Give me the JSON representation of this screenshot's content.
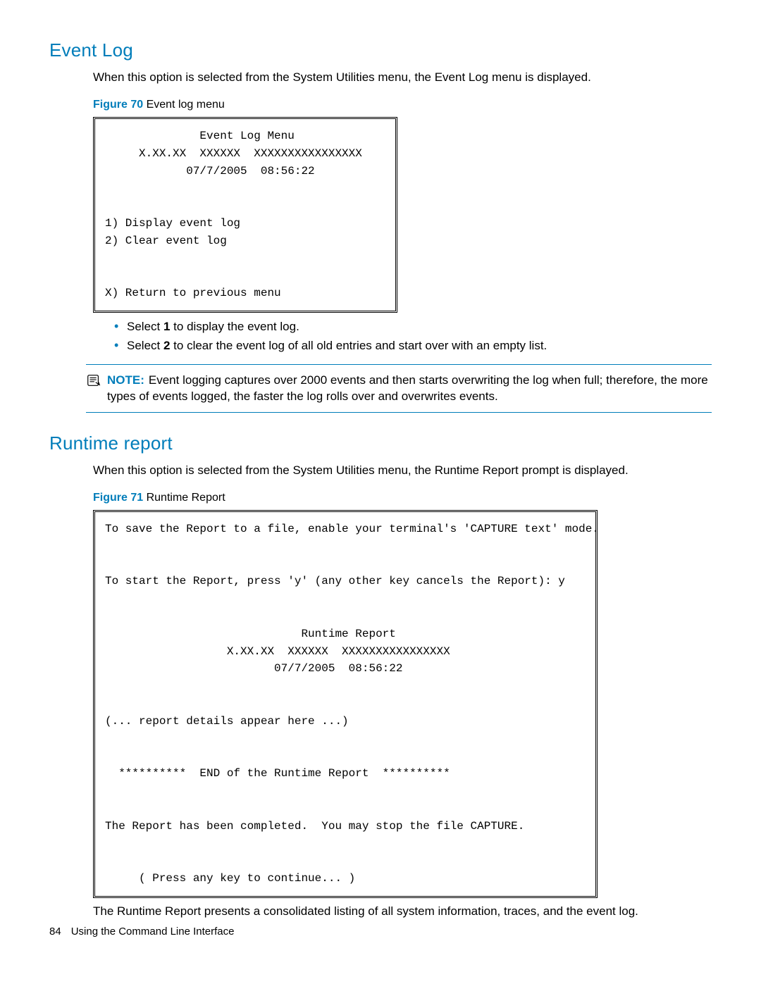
{
  "sections": {
    "eventLog": {
      "title": "Event Log",
      "intro": "When this option is selected from the System Utilities menu, the Event Log menu is displayed.",
      "figure": {
        "label_prefix": "Figure 70",
        "label_rest": " Event log menu",
        "screen": "              Event Log Menu\n     X.XX.XX  XXXXXX  XXXXXXXXXXXXXXXX\n            07/7/2005  08:56:22\n\n\n1) Display event log\n2) Clear event log\n\n\nX) Return to previous menu"
      },
      "bullets": {
        "b1_pre": "Select ",
        "b1_bold": "1",
        "b1_post": " to display the event log.",
        "b2_pre": "Select ",
        "b2_bold": "2",
        "b2_post": " to clear the event log of all old entries and start over with an empty list."
      },
      "note": {
        "label": "NOTE:",
        "text": "Event logging captures over 2000 events and then starts overwriting the log when full; therefore, the more types of events logged, the faster the log rolls over and overwrites events."
      }
    },
    "runtime": {
      "title": "Runtime report",
      "intro": "When this option is selected from the System Utilities menu, the Runtime Report prompt is displayed.",
      "figure": {
        "label_prefix": "Figure 71",
        "label_rest": " Runtime Report",
        "screen": "To save the Report to a file, enable your terminal's 'CAPTURE text' mode.\n\n\nTo start the Report, press 'y' (any other key cancels the Report): y\n\n\n                             Runtime Report\n                  X.XX.XX  XXXXXX  XXXXXXXXXXXXXXXX\n                         07/7/2005  08:56:22\n\n\n(... report details appear here ...)\n\n\n  **********  END of the Runtime Report  **********\n\n\nThe Report has been completed.  You may stop the file CAPTURE.\n\n\n     ( Press any key to continue... )"
      },
      "closing": "The Runtime Report presents a consolidated listing of all system information, traces, and the event log."
    }
  },
  "footer": {
    "page_number": "84",
    "section_title": "Using the Command Line Interface"
  }
}
